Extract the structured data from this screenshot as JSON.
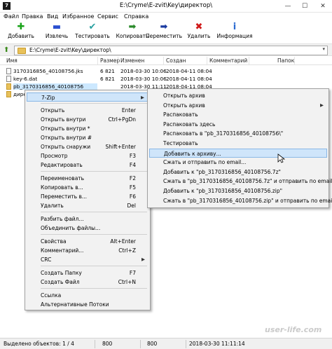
{
  "window": {
    "title": "E:\\Cryme\\E-zvit\\Key\\директор\\",
    "app_icon_text": "7",
    "min": "—",
    "max": "☐",
    "close": "✕"
  },
  "menu": [
    "Файл",
    "Правка",
    "Вид",
    "Избранное",
    "Сервис",
    "Справка"
  ],
  "toolbar": [
    {
      "label": "Добавить",
      "glyph": "✚",
      "color": "#1aa31a"
    },
    {
      "label": "Извлечь",
      "glyph": "▬",
      "color": "#2a4fd0"
    },
    {
      "label": "Тестировать",
      "glyph": "✔",
      "color": "#2aa0a0"
    },
    {
      "label": "Копировать",
      "glyph": "➡",
      "color": "#2a8a2a"
    },
    {
      "label": "Переместить",
      "glyph": "➡",
      "color": "#1a3aa0"
    },
    {
      "label": "Удалить",
      "glyph": "✖",
      "color": "#d01a1a"
    },
    {
      "label": "Информация",
      "glyph": "i",
      "color": "#2a6ad0"
    }
  ],
  "address": {
    "path": "E:\\Cryme\\E-zvit\\Key\\директор\\",
    "up_icon": "⬆",
    "dropdown": "▾"
  },
  "columns": [
    "Имя",
    "Размер",
    "Изменен",
    "Создан",
    "Комментарий",
    "Папок"
  ],
  "files": [
    {
      "name": "3170316856_40108756.jks",
      "size": "6 821",
      "modified": "2018-03-30 10:06",
      "created": "2018-04-11 08:04"
    },
    {
      "name": "key-6.dat",
      "size": "6 821",
      "modified": "2018-03-30 10:06",
      "created": "2018-04-11 08:04"
    },
    {
      "name": "pb_3170316856_40108756",
      "size": "",
      "modified": "2018-03-30 11:11",
      "created": "2018-04-11 08:04"
    },
    {
      "name": "дире",
      "size": "",
      "modified": "",
      "created": ""
    }
  ],
  "context_menu": {
    "groups": [
      [
        {
          "label": "7-Zip",
          "shortcut": "",
          "submenu": true,
          "highlighted": true
        }
      ],
      [
        {
          "label": "Открыть",
          "shortcut": "Enter"
        },
        {
          "label": "Открыть внутри",
          "shortcut": "Ctrl+PgDn"
        },
        {
          "label": "Открыть внутри *",
          "shortcut": ""
        },
        {
          "label": "Открыть внутри #",
          "shortcut": ""
        },
        {
          "label": "Открыть снаружи",
          "shortcut": "Shift+Enter"
        },
        {
          "label": "Просмотр",
          "shortcut": "F3"
        },
        {
          "label": "Редактировать",
          "shortcut": "F4"
        }
      ],
      [
        {
          "label": "Переименовать",
          "shortcut": "F2"
        },
        {
          "label": "Копировать в...",
          "shortcut": "F5"
        },
        {
          "label": "Переместить в...",
          "shortcut": "F6"
        },
        {
          "label": "Удалить",
          "shortcut": "Del"
        }
      ],
      [
        {
          "label": "Разбить файл...",
          "shortcut": ""
        },
        {
          "label": "Объединить файлы...",
          "shortcut": ""
        }
      ],
      [
        {
          "label": "Свойства",
          "shortcut": "Alt+Enter"
        },
        {
          "label": "Комментарий...",
          "shortcut": "Ctrl+Z"
        },
        {
          "label": "CRC",
          "shortcut": "",
          "submenu": true
        }
      ],
      [
        {
          "label": "Создать Папку",
          "shortcut": "F7"
        },
        {
          "label": "Создать Файл",
          "shortcut": "Ctrl+N"
        }
      ],
      [
        {
          "label": "Ссылка",
          "shortcut": ""
        },
        {
          "label": "Альтернативные Потоки",
          "shortcut": ""
        }
      ]
    ],
    "submenu_arrow": "▶"
  },
  "submenu": {
    "items": [
      {
        "label": "Открыть архив"
      },
      {
        "label": "Открыть архив",
        "submenu": true
      },
      {
        "label": "Распаковать"
      },
      {
        "label": "Распаковать здесь"
      },
      {
        "label": "Распаковать в \"pb_3170316856_40108756\\\""
      },
      {
        "label": "Тестировать"
      },
      {
        "label": "Добавить к архиву...",
        "highlighted": true
      },
      {
        "label": "Сжать и отправить по email..."
      },
      {
        "label": "Добавить к \"pb_3170316856_40108756.7z\""
      },
      {
        "label": "Сжать в \"pb_3170316856_40108756.7z\" и отправить по email"
      },
      {
        "label": "Добавить к \"pb_3170316856_40108756.zip\""
      },
      {
        "label": "Сжать в \"pb_3170316856_40108756.zip\" и отправить по email"
      }
    ]
  },
  "status": [
    "Выделено объектов: 1 / 4",
    "800",
    "800",
    "2018-03-30 11:11:14"
  ],
  "watermark": "user-life.com"
}
